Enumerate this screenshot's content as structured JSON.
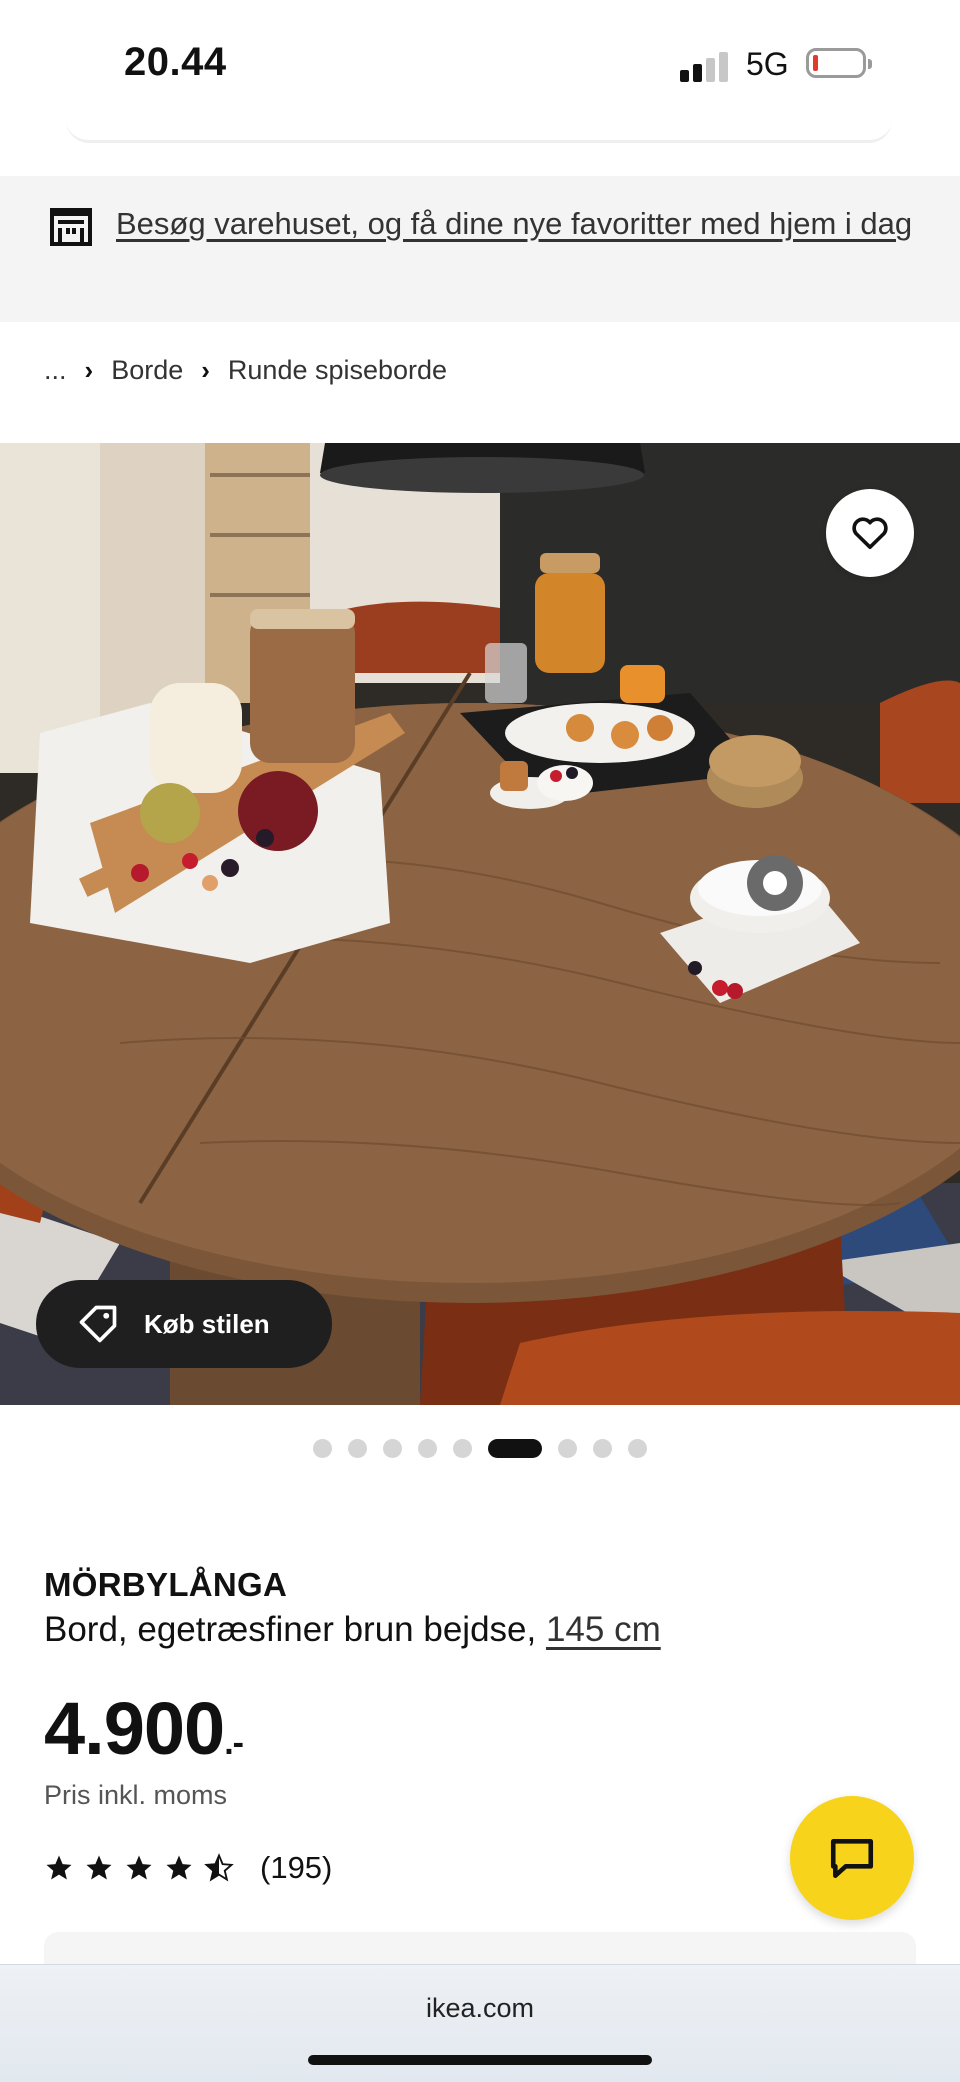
{
  "status_bar": {
    "time": "20.44",
    "network": "5G",
    "signal_bars": 2,
    "battery_color": "#e23b2d"
  },
  "banner": {
    "icon": "store-icon",
    "text": "Besøg varehuset, og få dine nye favoritter med hjem i dag"
  },
  "breadcrumb": {
    "items": [
      "...",
      "Borde",
      "Runde spiseborde"
    ]
  },
  "gallery": {
    "favorite_icon": "heart-icon",
    "shop_style_label": "Køb stilen",
    "shop_style_icon": "tag-icon",
    "dot_count": 9,
    "active_index": 5
  },
  "product": {
    "name": "MÖRBYLÅNGA",
    "description": "Bord, egetræsfiner brun bejdse,",
    "size_link": "145 cm",
    "price": "4.900",
    "price_suffix": ".-",
    "price_note": "Pris inkl. moms",
    "rating_stars": 4.5,
    "review_count": "(195)"
  },
  "chat": {
    "icon": "chat-bubble-icon",
    "color": "#f7d31b"
  },
  "browser": {
    "url": "ikea.com"
  }
}
